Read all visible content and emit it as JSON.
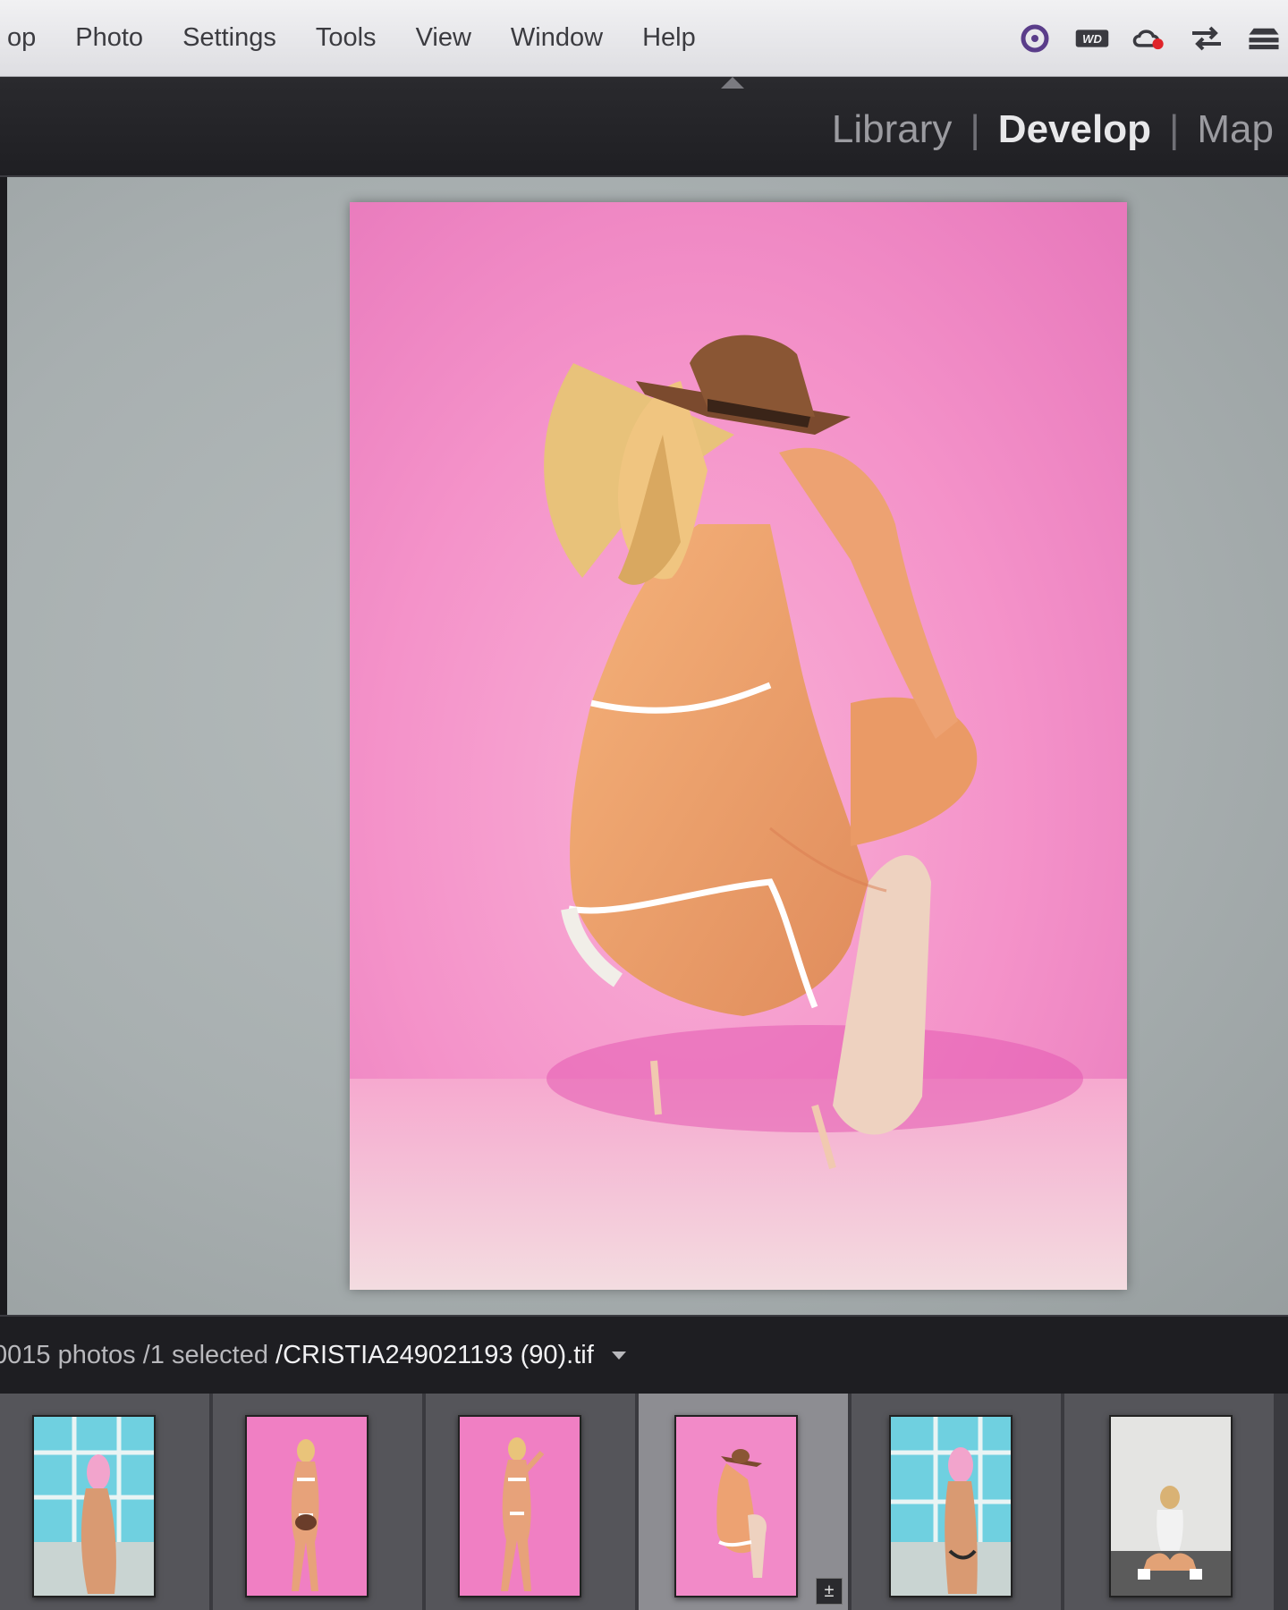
{
  "menu": {
    "items": [
      {
        "label": "op"
      },
      {
        "label": "Photo"
      },
      {
        "label": "Settings"
      },
      {
        "label": "Tools"
      },
      {
        "label": "View"
      },
      {
        "label": "Window"
      },
      {
        "label": "Help"
      }
    ]
  },
  "status_icons": [
    "vpn-icon",
    "wd-drive-icon",
    "creative-cloud-icon",
    "transfer-icon",
    "stack-icon"
  ],
  "status_wd_label": "WD",
  "modules": {
    "items": [
      {
        "label": "Library",
        "active": false
      },
      {
        "label": "Develop",
        "active": true
      },
      {
        "label": "Map",
        "active": false
      }
    ]
  },
  "info_bar": {
    "count": "0015 photos",
    "selected": "/1 selected",
    "filename": "/CRISTIA249021193 (90).tif"
  },
  "filmstrip": {
    "selected_index": 3,
    "thumbs": [
      {
        "scene": "window",
        "selected": false
      },
      {
        "scene": "pink",
        "selected": false
      },
      {
        "scene": "pink",
        "selected": false
      },
      {
        "scene": "pink-crouch",
        "selected": true
      },
      {
        "scene": "window",
        "selected": false
      },
      {
        "scene": "white",
        "selected": false
      }
    ]
  },
  "colors": {
    "pink_bg": "#f07fc3",
    "window_bg": "#4fb9d0",
    "white_bg": "#e4e4e2"
  }
}
